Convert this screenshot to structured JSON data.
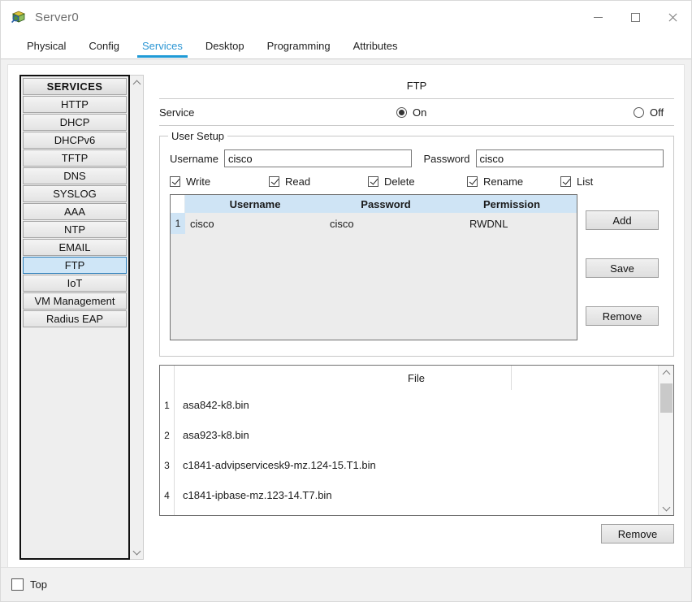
{
  "window": {
    "title": "Server0",
    "icon": "packet-tracer-server-icon",
    "controls": {
      "minimize": "minimize-icon",
      "maximize": "maximize-icon",
      "close": "close-icon"
    }
  },
  "tabs": [
    {
      "label": "Physical",
      "active": false
    },
    {
      "label": "Config",
      "active": false
    },
    {
      "label": "Services",
      "active": true
    },
    {
      "label": "Desktop",
      "active": false
    },
    {
      "label": "Programming",
      "active": false
    },
    {
      "label": "Attributes",
      "active": false
    }
  ],
  "sidebar": {
    "header": "SERVICES",
    "items": [
      {
        "label": "HTTP",
        "selected": false
      },
      {
        "label": "DHCP",
        "selected": false
      },
      {
        "label": "DHCPv6",
        "selected": false
      },
      {
        "label": "TFTP",
        "selected": false
      },
      {
        "label": "DNS",
        "selected": false
      },
      {
        "label": "SYSLOG",
        "selected": false
      },
      {
        "label": "AAA",
        "selected": false
      },
      {
        "label": "NTP",
        "selected": false
      },
      {
        "label": "EMAIL",
        "selected": false
      },
      {
        "label": "FTP",
        "selected": true
      },
      {
        "label": "IoT",
        "selected": false
      },
      {
        "label": "VM Management",
        "selected": false
      },
      {
        "label": "Radius EAP",
        "selected": false
      }
    ]
  },
  "main": {
    "title": "FTP",
    "service": {
      "label": "Service",
      "on_label": "On",
      "off_label": "Off",
      "value": "On"
    },
    "user_setup": {
      "legend": "User Setup",
      "username_label": "Username",
      "username_value": "cisco",
      "password_label": "Password",
      "password_value": "cisco",
      "permissions": [
        {
          "label": "Write",
          "checked": true
        },
        {
          "label": "Read",
          "checked": true
        },
        {
          "label": "Delete",
          "checked": true
        },
        {
          "label": "Rename",
          "checked": true
        },
        {
          "label": "List",
          "checked": true
        }
      ],
      "table": {
        "columns": [
          "Username",
          "Password",
          "Permission"
        ],
        "rows": [
          {
            "index": "1",
            "username": "cisco",
            "password": "cisco",
            "permission": "RWDNL"
          }
        ]
      },
      "buttons": {
        "add": "Add",
        "save": "Save",
        "remove": "Remove"
      }
    },
    "file_list": {
      "column_header": "File",
      "rows": [
        {
          "index": "1",
          "name": "asa842-k8.bin"
        },
        {
          "index": "2",
          "name": "asa923-k8.bin"
        },
        {
          "index": "3",
          "name": "c1841-advipservicesk9-mz.124-15.T1.bin"
        },
        {
          "index": "4",
          "name": "c1841-ipbase-mz.123-14.T7.bin"
        }
      ],
      "remove_button": "Remove"
    }
  },
  "footer": {
    "top_label": "Top",
    "top_checked": false
  },
  "colors": {
    "accent": "#1f9ad6",
    "tab_active_text": "#2b96d4",
    "table_header_bg": "#cfe4f5",
    "selected_item_bg": "#cfe6f7"
  }
}
